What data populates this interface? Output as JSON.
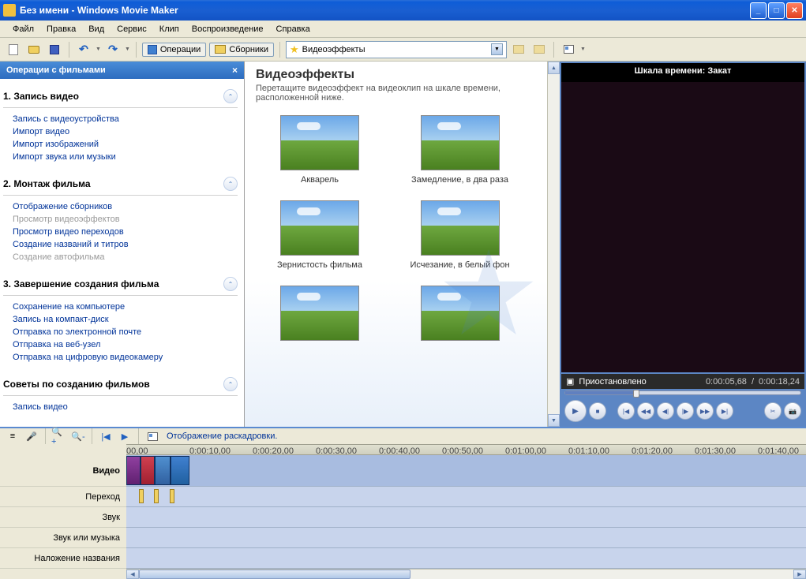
{
  "window": {
    "title": "Без имени - Windows Movie Maker"
  },
  "menu": {
    "file": "Файл",
    "edit": "Правка",
    "view": "Вид",
    "tools": "Сервис",
    "clip": "Клип",
    "play": "Воспроизведение",
    "help": "Справка"
  },
  "toolbar": {
    "tasks_label": "Операции",
    "collections_label": "Сборники",
    "location_value": "Видеоэффекты"
  },
  "tasks": {
    "header": "Операции с фильмами",
    "section1": {
      "title": "1. Запись видео",
      "links": [
        "Запись с видеоустройства",
        "Импорт видео",
        "Импорт изображений",
        "Импорт звука или музыки"
      ]
    },
    "section2": {
      "title": "2. Монтаж фильма",
      "links": [
        "Отображение сборников",
        "Просмотр видеоэффектов",
        "Просмотр видео переходов",
        "Создание названий и титров",
        "Создание автофильма"
      ],
      "disabled": [
        1,
        4
      ]
    },
    "section3": {
      "title": "3. Завершение создания фильма",
      "links": [
        "Сохранение на компьютере",
        "Запись на компакт-диск",
        "Отправка по электронной почте",
        "Отправка на веб-узел",
        "Отправка на цифровую видеокамеру"
      ]
    },
    "section4": {
      "title": "Советы по созданию фильмов",
      "links": [
        "Запись видео"
      ]
    }
  },
  "content": {
    "title": "Видеоэффекты",
    "subtitle": "Перетащите видеоэффект на видеоклип на шкале времени, расположенной ниже.",
    "effects": [
      "Акварель",
      "Замедление, в два раза",
      "Зернистость фильма",
      "Исчезание, в белый фон",
      "",
      ""
    ]
  },
  "preview": {
    "title": "Шкала времени: Закат",
    "status": "Приостановлено",
    "time_current": "0:00:05,68",
    "time_total": "0:00:18,24"
  },
  "timeline": {
    "mode_label": "Отображение раскадровки.",
    "ticks": [
      "00,00",
      "0:00:10,00",
      "0:00:20,00",
      "0:00:30,00",
      "0:00:40,00",
      "0:00:50,00",
      "0:01:00,00",
      "0:01:10,00",
      "0:01:20,00",
      "0:01:30,00",
      "0:01:40,00"
    ],
    "tracks": {
      "video": "Видео",
      "transition": "Переход",
      "audio": "Звук",
      "audio_music": "Звук или музыка",
      "title_overlay": "Наложение названия"
    }
  }
}
